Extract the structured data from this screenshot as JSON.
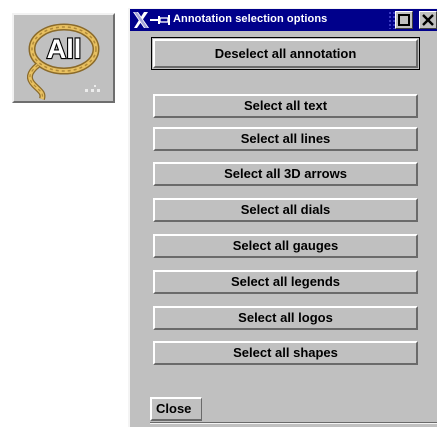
{
  "toolbar_icon": {
    "label": "All",
    "icon": "lasso-all-icon"
  },
  "window": {
    "title": "Annotation selection options",
    "icons": [
      "x-logo-icon",
      "pin-icon",
      "maximize-icon",
      "close-icon"
    ]
  },
  "buttons": {
    "deselect_all": "Deselect all annotation",
    "select_all_text": "Select all text",
    "select_all_lines": "Select all lines",
    "select_all_3d_arrows": "Select all 3D arrows",
    "select_all_dials": "Select all dials",
    "select_all_gauges": "Select all gauges",
    "select_all_legends": "Select all legends",
    "select_all_logos": "Select all logos",
    "select_all_shapes": "Select all shapes",
    "close": "Close"
  },
  "colors": {
    "titlebar": "#00008b",
    "face": "#c0c0c0"
  }
}
